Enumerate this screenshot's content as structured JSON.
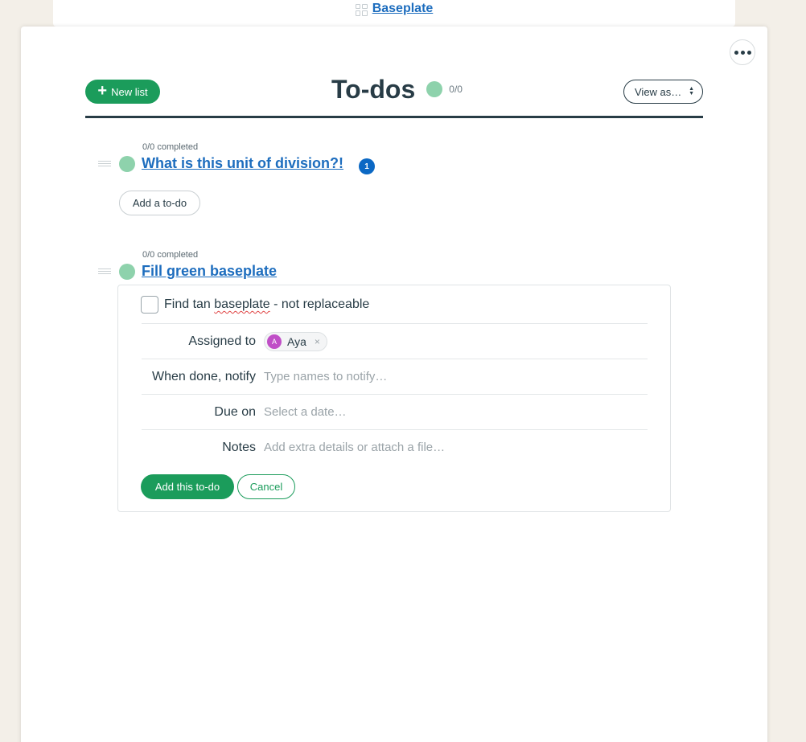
{
  "breadcrumb": {
    "label": "Baseplate",
    "icon": "grid-icon"
  },
  "header": {
    "new_list_label": "New list",
    "title": "To-dos",
    "count": "0/0",
    "view_select": "View as…"
  },
  "lists": [
    {
      "completed": "0/0 completed",
      "title": "What is this unit of division?!",
      "badge": "1",
      "add_todo_label": "Add a to-do"
    },
    {
      "completed": "0/0 completed",
      "title": "Fill green baseplate"
    }
  ],
  "form": {
    "todo_text_prefix": "Find tan ",
    "todo_text_word": "baseplate",
    "todo_text_suffix": " - not replaceable",
    "assigned_label": "Assigned to",
    "assignee_initial": "A",
    "assignee_name": "Aya",
    "remove_glyph": "×",
    "notify_label": "When done, notify",
    "notify_placeholder": "Type names to notify…",
    "due_label": "Due on",
    "due_placeholder": "Select a date…",
    "notes_label": "Notes",
    "notes_placeholder": "Add extra details or attach a file…",
    "submit_label": "Add this to-do",
    "cancel_label": "Cancel"
  },
  "colors": {
    "accent": "#1b9c5b",
    "link": "#1d6dbe",
    "status_dot": "#8ed2ac",
    "badge": "#0b68c4"
  }
}
